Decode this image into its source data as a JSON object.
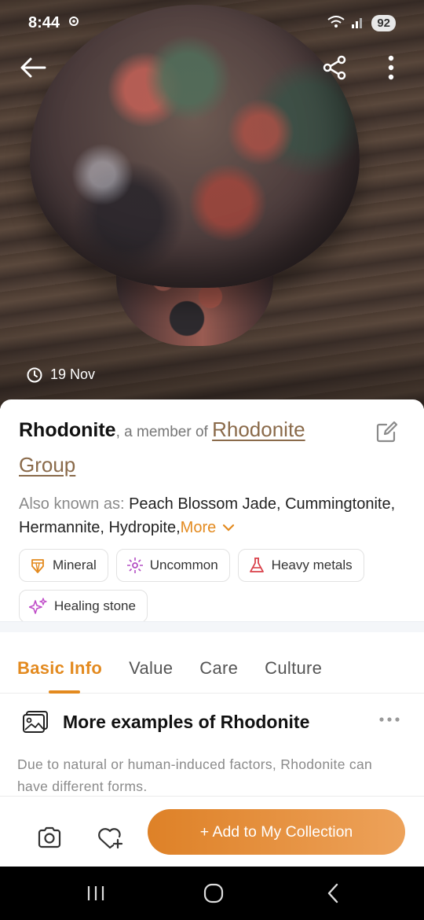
{
  "status_bar": {
    "time": "8:44",
    "battery": "92"
  },
  "hero": {
    "date": "19 Nov"
  },
  "specimen": {
    "name": "Rhodonite",
    "member_text": ", a member of ",
    "group": "Rhodonite Group",
    "aka_label": "Also known as: ",
    "aka_names": "Peach Blossom Jade, Cummingtonite, Hermannite, Hydropite,",
    "aka_more": "More"
  },
  "tags": [
    {
      "label": "Mineral",
      "icon": "gem-icon"
    },
    {
      "label": "Uncommon",
      "icon": "sparkle-icon"
    },
    {
      "label": "Heavy metals",
      "icon": "flask-icon"
    },
    {
      "label": "Healing stone",
      "icon": "sparkles-icon"
    }
  ],
  "tabs": [
    "Basic Info",
    "Value",
    "Care",
    "Culture"
  ],
  "section": {
    "title": "More examples of Rhodonite",
    "description": "Due to natural or human-induced factors, Rhodonite can have different forms."
  },
  "actions": {
    "add_label": "+ Add to My Collection"
  },
  "colors": {
    "accent": "#e38a1f",
    "link": "#8a6a4a"
  }
}
